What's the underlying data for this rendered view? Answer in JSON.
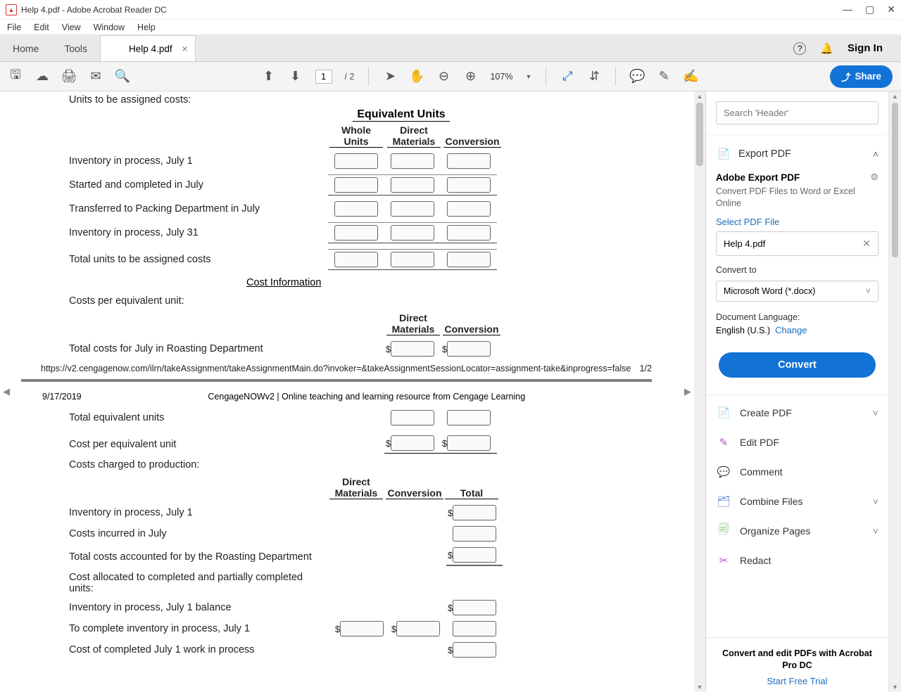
{
  "titlebar": {
    "icon_label": "PDF",
    "title": "Help 4.pdf - Adobe Acrobat Reader DC"
  },
  "menubar": [
    "File",
    "Edit",
    "View",
    "Window",
    "Help"
  ],
  "tabs": {
    "home": "Home",
    "tools": "Tools",
    "file": "Help 4.pdf",
    "signin": "Sign In"
  },
  "toolbar": {
    "page_current": "1",
    "page_total": "/ 2",
    "zoom": "107%",
    "share": "Share"
  },
  "doc": {
    "section1": {
      "units_label": "Units to be assigned costs:",
      "eq_units": "Equivalent Units",
      "col_whole1": "Whole",
      "col_whole2": "Units",
      "col_dm1": "Direct",
      "col_dm2": "Materials",
      "col_conv": "Conversion",
      "rows": [
        "Inventory in process, July 1",
        "Started and completed in July",
        "Transferred to Packing Department in July",
        "Inventory in process, July 31",
        "Total units to be assigned costs"
      ],
      "cost_info": "Cost Information",
      "costs_per_eq": "Costs per equivalent unit:",
      "h2_dm1": "Direct",
      "h2_dm2": "Materials",
      "h2_conv": "Conversion",
      "total_costs_july": "Total costs for July in Roasting Department",
      "footer_url": "https://v2.cengagenow.com/ilrn/takeAssignment/takeAssignmentMain.do?invoker=&takeAssignmentSessionLocator=assignment-take&inprogress=false",
      "footer_pg": "1/2"
    },
    "section2": {
      "date": "9/17/2019",
      "header": "CengageNOWv2 | Online teaching and learning resource from Cengage Learning",
      "rows1": [
        "Total equivalent units",
        "Cost per equivalent unit"
      ],
      "costs_charged": "Costs charged to production:",
      "h3_dm1": "Direct",
      "h3_dm2": "Materials",
      "h3_conv": "Conversion",
      "h3_total": "Total",
      "rows2": [
        "Inventory in process, July 1",
        "Costs incurred in July",
        "Total costs accounted for by the Roasting Department",
        "Cost allocated to completed and partially completed units:",
        "Inventory in process, July 1 balance",
        "To complete inventory in process, July 1",
        "Cost of completed July 1 work in process"
      ]
    }
  },
  "rpanel": {
    "search_placeholder": "Search 'Header'",
    "export": {
      "title": "Export PDF",
      "subhead": "Adobe Export PDF",
      "desc": "Convert PDF Files to Word or Excel Online",
      "select_label": "Select PDF File",
      "filename": "Help 4.pdf",
      "convert_to": "Convert to",
      "format": "Microsoft Word (*.docx)",
      "doclang_label": "Document Language:",
      "doclang": "English (U.S.)",
      "change": "Change",
      "convert_btn": "Convert"
    },
    "tools": [
      "Create PDF",
      "Edit PDF",
      "Comment",
      "Combine Files",
      "Organize Pages",
      "Redact"
    ],
    "trial": {
      "line": "Convert and edit PDFs with Acrobat Pro DC",
      "link": "Start Free Trial"
    }
  }
}
